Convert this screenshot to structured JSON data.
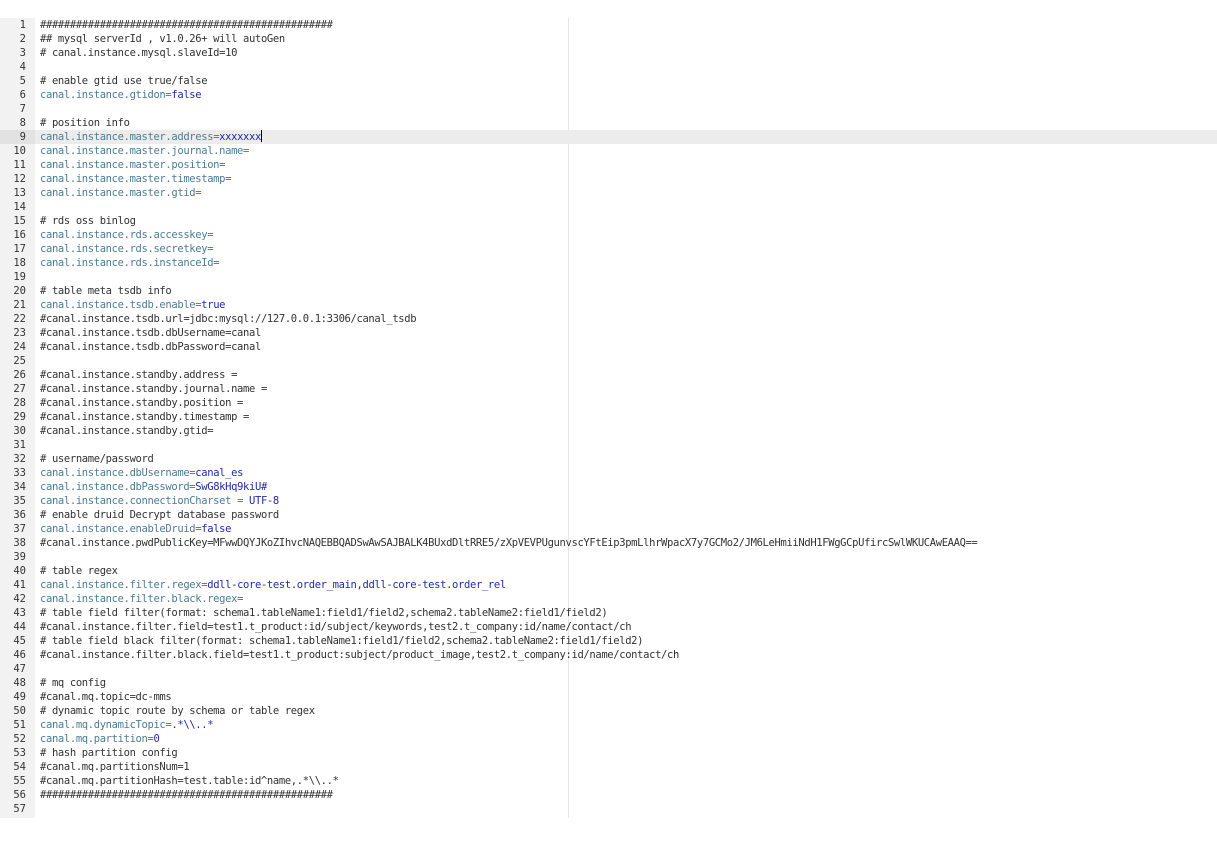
{
  "editor": {
    "cursor_line": 9,
    "lines": [
      {
        "n": "1",
        "kind": "comment",
        "text": "#################################################"
      },
      {
        "n": "2",
        "kind": "comment",
        "text": "## mysql serverId , v1.0.26+ will autoGen"
      },
      {
        "n": "3",
        "kind": "comment",
        "text": "# canal.instance.mysql.slaveId=10"
      },
      {
        "n": "4",
        "kind": "blank",
        "text": ""
      },
      {
        "n": "5",
        "kind": "comment",
        "text": "# enable gtid use true/false"
      },
      {
        "n": "6",
        "kind": "prop",
        "key": "canal.instance.gtidon",
        "eq": "=",
        "val": "false"
      },
      {
        "n": "7",
        "kind": "blank",
        "text": ""
      },
      {
        "n": "8",
        "kind": "comment",
        "text": "# position info"
      },
      {
        "n": "9",
        "kind": "prop",
        "key": "canal.instance.master.address",
        "eq": "=",
        "val": "xxxxxxx"
      },
      {
        "n": "10",
        "kind": "prop",
        "key": "canal.instance.master.journal.name",
        "eq": "=",
        "val": ""
      },
      {
        "n": "11",
        "kind": "prop",
        "key": "canal.instance.master.position",
        "eq": "=",
        "val": ""
      },
      {
        "n": "12",
        "kind": "prop",
        "key": "canal.instance.master.timestamp",
        "eq": "=",
        "val": ""
      },
      {
        "n": "13",
        "kind": "prop",
        "key": "canal.instance.master.gtid",
        "eq": "=",
        "val": ""
      },
      {
        "n": "14",
        "kind": "blank",
        "text": ""
      },
      {
        "n": "15",
        "kind": "comment",
        "text": "# rds oss binlog"
      },
      {
        "n": "16",
        "kind": "prop",
        "key": "canal.instance.rds.accesskey",
        "eq": "=",
        "val": ""
      },
      {
        "n": "17",
        "kind": "prop",
        "key": "canal.instance.rds.secretkey",
        "eq": "=",
        "val": ""
      },
      {
        "n": "18",
        "kind": "prop",
        "key": "canal.instance.rds.instanceId",
        "eq": "=",
        "val": ""
      },
      {
        "n": "19",
        "kind": "blank",
        "text": ""
      },
      {
        "n": "20",
        "kind": "comment",
        "text": "# table meta tsdb info"
      },
      {
        "n": "21",
        "kind": "prop",
        "key": "canal.instance.tsdb.enable",
        "eq": "=",
        "val": "true"
      },
      {
        "n": "22",
        "kind": "comment",
        "text": "#canal.instance.tsdb.url=jdbc:mysql://127.0.0.1:3306/canal_tsdb"
      },
      {
        "n": "23",
        "kind": "comment",
        "text": "#canal.instance.tsdb.dbUsername=canal"
      },
      {
        "n": "24",
        "kind": "comment",
        "text": "#canal.instance.tsdb.dbPassword=canal"
      },
      {
        "n": "25",
        "kind": "blank",
        "text": ""
      },
      {
        "n": "26",
        "kind": "comment",
        "text": "#canal.instance.standby.address ="
      },
      {
        "n": "27",
        "kind": "comment",
        "text": "#canal.instance.standby.journal.name ="
      },
      {
        "n": "28",
        "kind": "comment",
        "text": "#canal.instance.standby.position ="
      },
      {
        "n": "29",
        "kind": "comment",
        "text": "#canal.instance.standby.timestamp ="
      },
      {
        "n": "30",
        "kind": "comment",
        "text": "#canal.instance.standby.gtid="
      },
      {
        "n": "31",
        "kind": "blank",
        "text": ""
      },
      {
        "n": "32",
        "kind": "comment",
        "text": "# username/password"
      },
      {
        "n": "33",
        "kind": "prop",
        "key": "canal.instance.dbUsername",
        "eq": "=",
        "val": "canal_es"
      },
      {
        "n": "34",
        "kind": "prop",
        "key": "canal.instance.dbPassword",
        "eq": "=",
        "val": "SwG8kHq9kiU#"
      },
      {
        "n": "35",
        "kind": "prop",
        "key": "canal.instance.connectionCharset",
        "eq": " = ",
        "val": "UTF-8"
      },
      {
        "n": "36",
        "kind": "comment",
        "text": "# enable druid Decrypt database password"
      },
      {
        "n": "37",
        "kind": "prop",
        "key": "canal.instance.enableDruid",
        "eq": "=",
        "val": "false"
      },
      {
        "n": "38",
        "kind": "comment",
        "text": "#canal.instance.pwdPublicKey=MFwwDQYJKoZIhvcNAQEBBQADSwAwSAJBALK4BUxdDltRRE5/zXpVEVPUgunvscYFtEip3pmLlhrWpacX7y7GCMo2/JM6LeHmiiNdH1FWgGCpUfircSwlWKUCAwEAAQ=="
      },
      {
        "n": "39",
        "kind": "blank",
        "text": ""
      },
      {
        "n": "40",
        "kind": "comment",
        "text": "# table regex"
      },
      {
        "n": "41",
        "kind": "prop",
        "key": "canal.instance.filter.regex",
        "eq": "=",
        "val": "ddll-core-test.order_main,ddll-core-test.order_rel"
      },
      {
        "n": "42",
        "kind": "prop",
        "key": "canal.instance.filter.black.regex",
        "eq": "=",
        "val": ""
      },
      {
        "n": "43",
        "kind": "comment",
        "text": "# table field filter(format: schema1.tableName1:field1/field2,schema2.tableName2:field1/field2)"
      },
      {
        "n": "44",
        "kind": "comment",
        "text": "#canal.instance.filter.field=test1.t_product:id/subject/keywords,test2.t_company:id/name/contact/ch"
      },
      {
        "n": "45",
        "kind": "comment",
        "text": "# table field black filter(format: schema1.tableName1:field1/field2,schema2.tableName2:field1/field2)"
      },
      {
        "n": "46",
        "kind": "comment",
        "text": "#canal.instance.filter.black.field=test1.t_product:subject/product_image,test2.t_company:id/name/contact/ch"
      },
      {
        "n": "47",
        "kind": "blank",
        "text": ""
      },
      {
        "n": "48",
        "kind": "comment",
        "text": "# mq config"
      },
      {
        "n": "49",
        "kind": "comment",
        "text": "#canal.mq.topic=dc-mms"
      },
      {
        "n": "50",
        "kind": "comment",
        "text": "# dynamic topic route by schema or table regex"
      },
      {
        "n": "51",
        "kind": "prop",
        "key": "canal.mq.dynamicTopic",
        "eq": "=",
        "val": ".*\\\\..*"
      },
      {
        "n": "52",
        "kind": "prop",
        "key": "canal.mq.partition",
        "eq": "=",
        "val": "0"
      },
      {
        "n": "53",
        "kind": "comment",
        "text": "# hash partition config"
      },
      {
        "n": "54",
        "kind": "comment",
        "text": "#canal.mq.partitionsNum=1"
      },
      {
        "n": "55",
        "kind": "comment",
        "text": "#canal.mq.partitionHash=test.table:id^name,.*\\\\..*"
      },
      {
        "n": "56",
        "kind": "comment",
        "text": "#################################################"
      },
      {
        "n": "57",
        "kind": "blank",
        "text": ""
      }
    ]
  }
}
